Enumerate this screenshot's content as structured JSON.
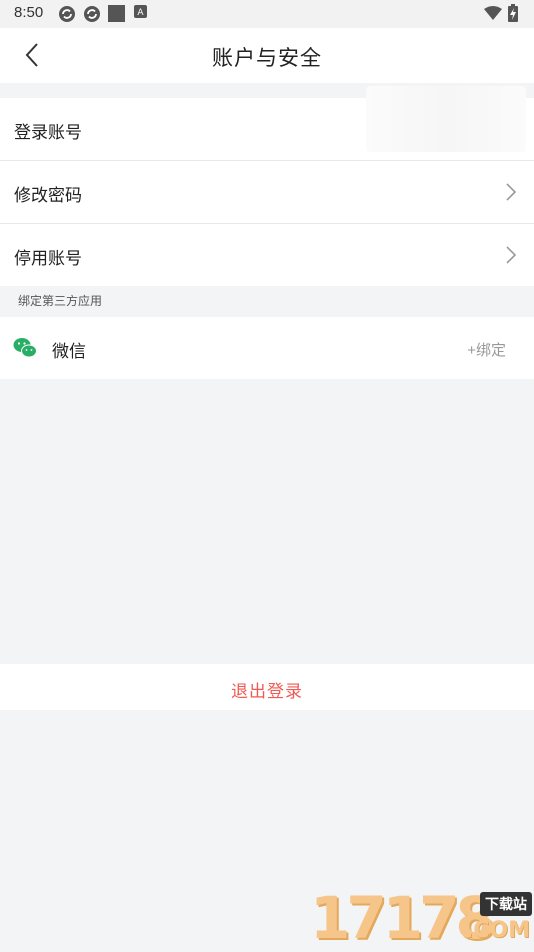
{
  "status_bar": {
    "time": "8:50",
    "left_icons": [
      "sync-icon",
      "sync-icon",
      "square-icon",
      "a-icon"
    ],
    "right_icons": [
      "wifi-icon",
      "battery-charging-icon"
    ]
  },
  "navbar": {
    "title": "账户与安全",
    "back_icon": "chevron-left-icon"
  },
  "account_group": {
    "items": [
      {
        "label": "登录账号"
      },
      {
        "label": "修改密码"
      },
      {
        "label": "停用账号"
      }
    ]
  },
  "third_party": {
    "section_label": "绑定第三方应用",
    "wechat": {
      "icon": "wechat-icon",
      "label": "微信",
      "action": "+绑定",
      "icon_color": "#2aae67"
    }
  },
  "logout": {
    "label": "退出登录",
    "color": "#f05a55"
  },
  "watermark": {
    "digits": "17178",
    "badge": "下载站",
    "suffix": ".COM"
  }
}
